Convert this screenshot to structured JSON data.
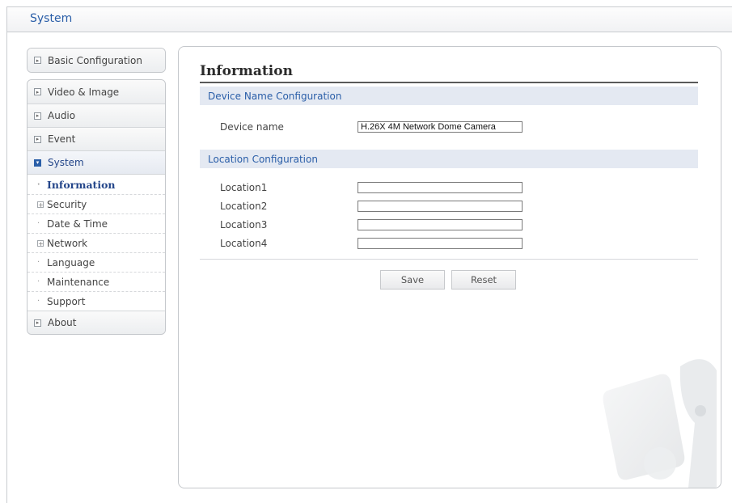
{
  "window": {
    "title": "System"
  },
  "sidebar": {
    "top": {
      "label": "Basic Configuration"
    },
    "items": [
      {
        "label": "Video & Image"
      },
      {
        "label": "Audio"
      },
      {
        "label": "Event"
      },
      {
        "label": "System"
      }
    ],
    "submenu": [
      {
        "label": "Information",
        "active": true
      },
      {
        "label": "Security",
        "expandable": true
      },
      {
        "label": "Date & Time"
      },
      {
        "label": "Network",
        "expandable": true
      },
      {
        "label": "Language"
      },
      {
        "label": "Maintenance"
      },
      {
        "label": "Support"
      }
    ],
    "bottom": {
      "label": "About"
    }
  },
  "content": {
    "title": "Information",
    "device_section": {
      "header": "Device Name Configuration",
      "label": "Device name",
      "value": "H.26X 4M Network Dome Camera"
    },
    "location_section": {
      "header": "Location Configuration",
      "fields": [
        {
          "label": "Location1",
          "value": ""
        },
        {
          "label": "Location2",
          "value": ""
        },
        {
          "label": "Location3",
          "value": ""
        },
        {
          "label": "Location4",
          "value": ""
        }
      ]
    },
    "buttons": {
      "save": "Save",
      "reset": "Reset"
    }
  },
  "colors": {
    "accent": "#2a5ea8",
    "section_bg": "#e4e9f2",
    "border": "#c5c8cc"
  }
}
